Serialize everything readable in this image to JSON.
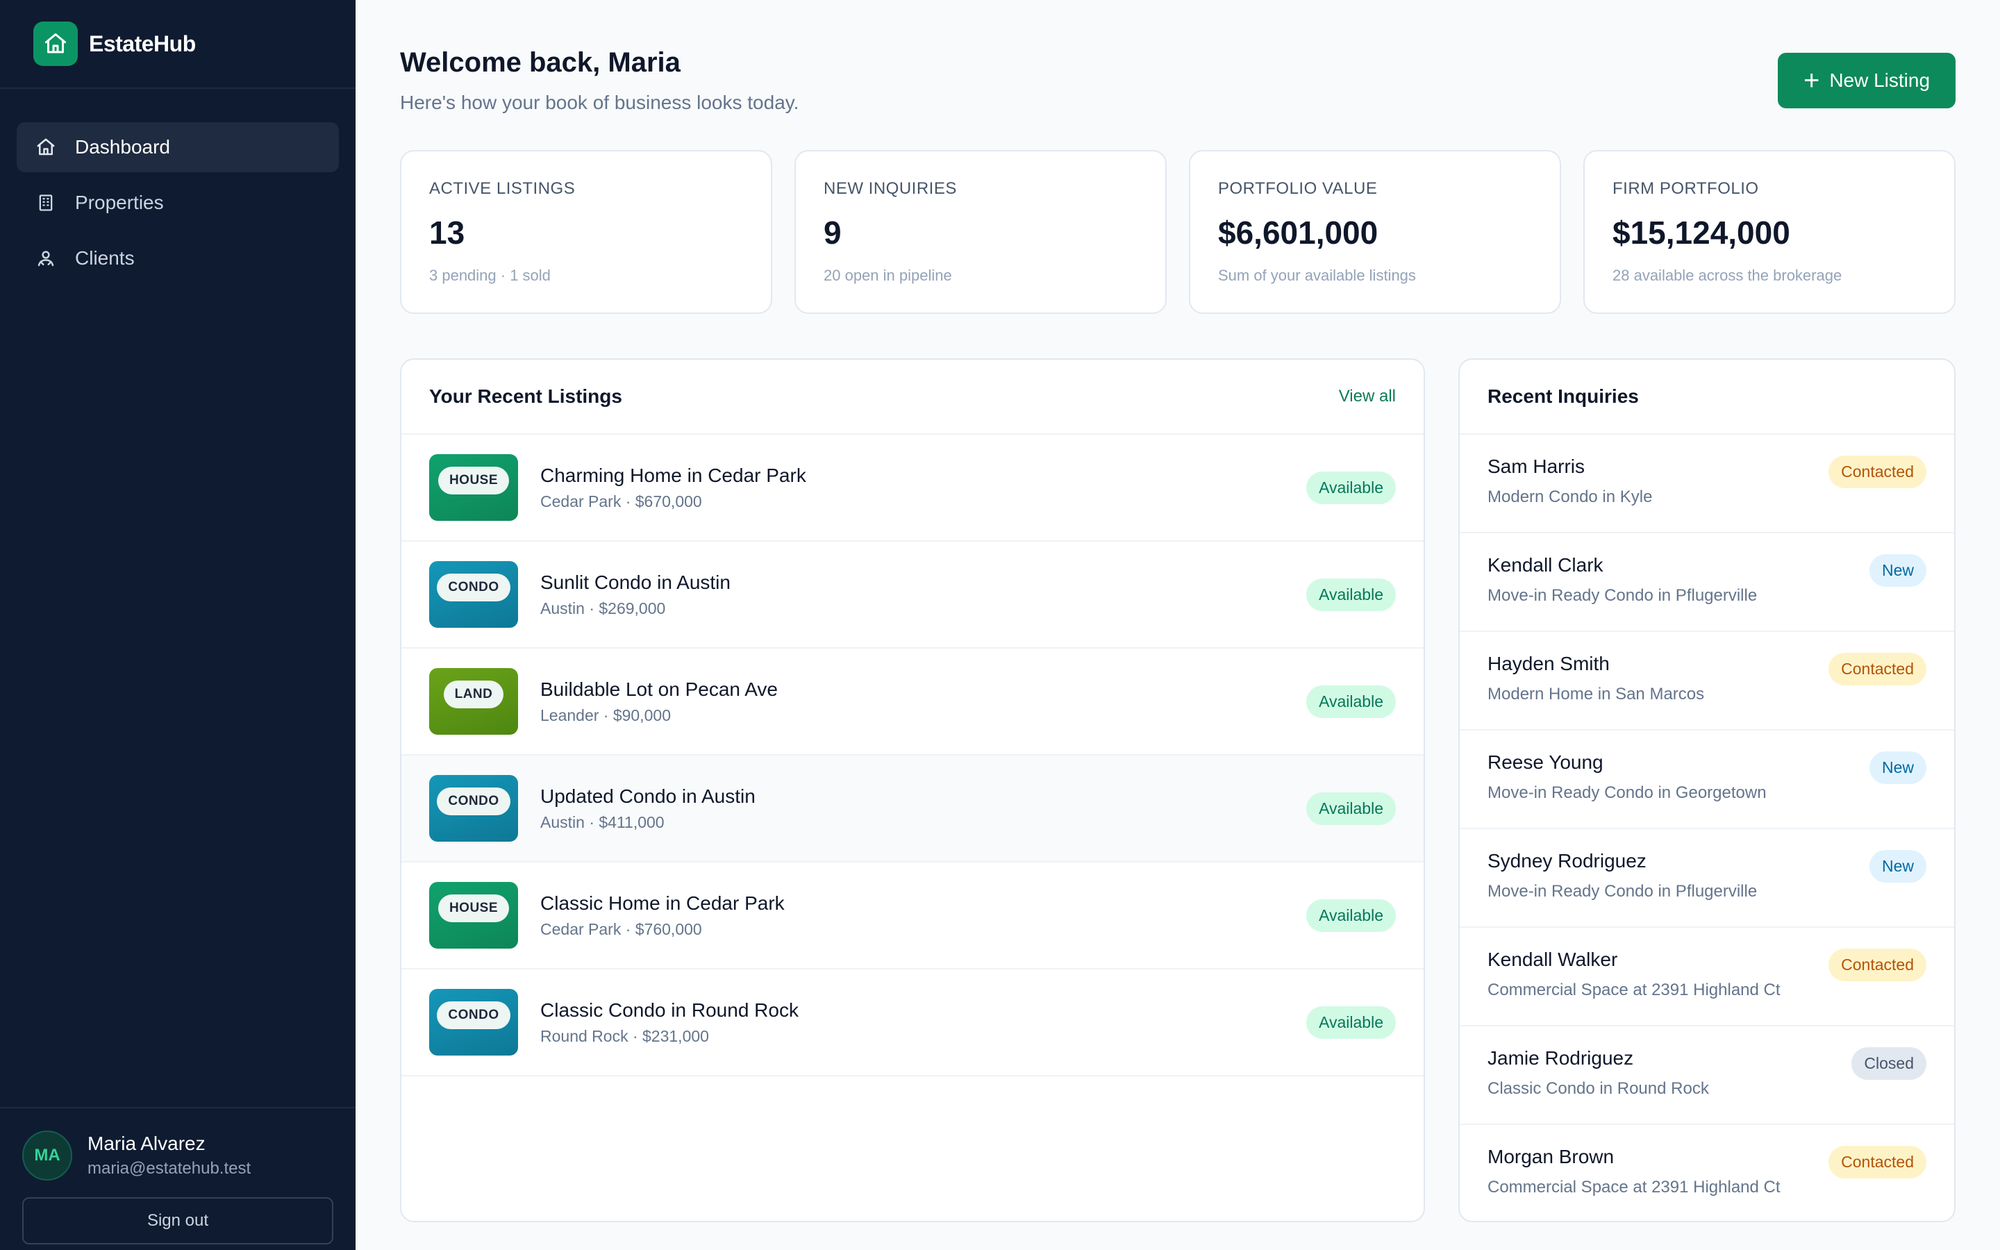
{
  "brand": {
    "name": "EstateHub",
    "icon": "house-icon"
  },
  "nav": [
    {
      "label": "Dashboard",
      "icon": "home-icon",
      "active": true
    },
    {
      "label": "Properties",
      "icon": "building-icon",
      "active": false
    },
    {
      "label": "Clients",
      "icon": "users-icon",
      "active": false
    }
  ],
  "user": {
    "initials": "MA",
    "name": "Maria Alvarez",
    "email": "maria@estatehub.test",
    "signout_label": "Sign out"
  },
  "header": {
    "title": "Welcome back, Maria",
    "subtitle": "Here's how your book of business looks today.",
    "new_listing_label": "New Listing"
  },
  "stats": [
    {
      "label": "ACTIVE LISTINGS",
      "value": "13",
      "note": "3 pending · 1 sold"
    },
    {
      "label": "NEW INQUIRIES",
      "value": "9",
      "note": "20 open in pipeline"
    },
    {
      "label": "PORTFOLIO VALUE",
      "value": "$6,601,000",
      "note": "Sum of your available listings"
    },
    {
      "label": "FIRM PORTFOLIO",
      "value": "$15,124,000",
      "note": "28 available across the brokerage"
    }
  ],
  "listings": {
    "title": "Your Recent Listings",
    "view_all_label": "View all",
    "items": [
      {
        "type": "HOUSE",
        "title": "Charming Home in Cedar Park",
        "meta": "Cedar Park · $670,000",
        "status": "Available"
      },
      {
        "type": "CONDO",
        "title": "Sunlit Condo in Austin",
        "meta": "Austin · $269,000",
        "status": "Available"
      },
      {
        "type": "LAND",
        "title": "Buildable Lot on Pecan Ave",
        "meta": "Leander · $90,000",
        "status": "Available"
      },
      {
        "type": "CONDO",
        "title": "Updated Condo in Austin",
        "meta": "Austin · $411,000",
        "status": "Available"
      },
      {
        "type": "HOUSE",
        "title": "Classic Home in Cedar Park",
        "meta": "Cedar Park · $760,000",
        "status": "Available"
      },
      {
        "type": "CONDO",
        "title": "Classic Condo in Round Rock",
        "meta": "Round Rock · $231,000",
        "status": "Available"
      }
    ]
  },
  "inquiries": {
    "title": "Recent Inquiries",
    "items": [
      {
        "name": "Sam Harris",
        "property": "Modern Condo in Kyle",
        "status": "Contacted"
      },
      {
        "name": "Kendall Clark",
        "property": "Move-in Ready Condo in Pflugerville",
        "status": "New"
      },
      {
        "name": "Hayden Smith",
        "property": "Modern Home in San Marcos",
        "status": "Contacted"
      },
      {
        "name": "Reese Young",
        "property": "Move-in Ready Condo in Georgetown",
        "status": "New"
      },
      {
        "name": "Sydney Rodriguez",
        "property": "Move-in Ready Condo in Pflugerville",
        "status": "New"
      },
      {
        "name": "Kendall Walker",
        "property": "Commercial Space at 2391 Highland Ct",
        "status": "Contacted"
      },
      {
        "name": "Jamie Rodriguez",
        "property": "Classic Condo in Round Rock",
        "status": "Closed"
      },
      {
        "name": "Morgan Brown",
        "property": "Commercial Space at 2391 Highland Ct",
        "status": "Contacted"
      }
    ]
  },
  "colors": {
    "accent": "#0c8a5c",
    "sidebar": "#0f1b31",
    "available_bg": "#d1fae5",
    "contacted_bg": "#fef3c7",
    "new_bg": "#e0f2fe",
    "closed_bg": "#e2e8f0"
  }
}
